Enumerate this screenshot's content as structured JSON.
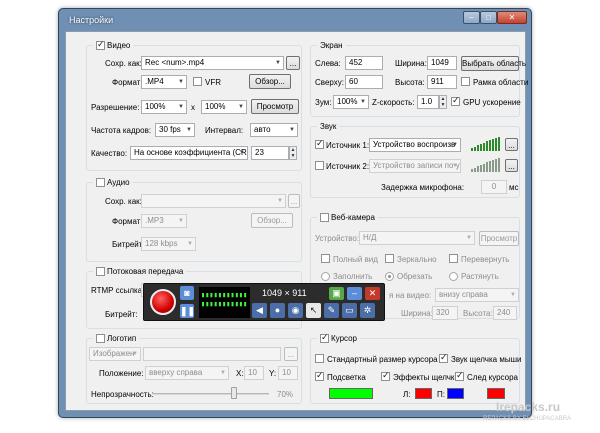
{
  "window": {
    "title": "Настройки"
  },
  "video": {
    "label": "Видео",
    "save_as_label": "Сохр. как:",
    "save_as_value": "Rec <num>.mp4",
    "format_label": "Формат:",
    "format_value": ".MP4",
    "vfr_label": "VFR",
    "browse_label": "Обзор...",
    "resolution_label": "Разрешение:",
    "res_w": "100%",
    "res_x": "x",
    "res_h": "100%",
    "preview_label": "Просмотр",
    "fps_label": "Частота кадров:",
    "fps_value": "30 fps",
    "interval_label": "Интервал:",
    "interval_value": "авто",
    "quality_label": "Качество:",
    "quality_mode": "На основе коэффициента (CR",
    "quality_value": "23",
    "more_label": "..."
  },
  "screen": {
    "label": "Экран",
    "left_label": "Слева:",
    "left_value": "452",
    "width_label": "Ширина:",
    "width_value": "1049",
    "select_area_label": "Выбрать область",
    "top_label": "Сверху:",
    "top_value": "60",
    "height_label": "Высота:",
    "height_value": "911",
    "frame_label": "Рамка области",
    "zoom_label": "Зум:",
    "zoom_value": "100%",
    "zspeed_label": "Z-скорость:",
    "zspeed_value": "1.0",
    "gpu_label": "GPU ускорение"
  },
  "sound": {
    "label": "Звук",
    "source1_label": "Источник 1:",
    "source1_value": "Устройство воспроизв",
    "source2_label": "Источник 2:",
    "source2_value": "Устройство записи по у",
    "mic_delay_label": "Задержка микрофона:",
    "mic_delay_value": "0",
    "mic_delay_unit": "мс"
  },
  "audio": {
    "label": "Аудио",
    "save_as_label": "Сохр. как:",
    "format_label": "Формат:",
    "format_value": ".MP3",
    "browse_label": "Обзор...",
    "bitrate_label": "Битрейт:",
    "bitrate_value": "128 kbps"
  },
  "webcam": {
    "label": "Веб-камера",
    "device_label": "Устройство:",
    "device_value": "Н/Д",
    "preview_label": "Просмотр",
    "fullview_label": "Полный вид",
    "mirror_label": "Зеркально",
    "flip_label": "Перевернуть",
    "fill_label": "Заполнить",
    "crop_label": "Обрезать",
    "stretch_label": "Растянуть",
    "position_label": "я на видео:",
    "position_value": "внизу справа",
    "width_label": "Ширина:",
    "width_value": "320",
    "height_label": "Высота:",
    "height_value": "240"
  },
  "stream": {
    "label": "Потоковая передача",
    "rtmp_label": "RTMP ссылка:",
    "bitrate_label": "Битрейт:"
  },
  "logo": {
    "label": "Логотип",
    "type_value": "Изображен",
    "position_label": "Положение:",
    "position_value": "вверху справа",
    "x_label": "X:",
    "x_value": "10",
    "y_label": "Y:",
    "y_value": "10",
    "opacity_label": "Непрозрачность:",
    "opacity_value": "70%",
    "opacity_fraction": 0.7
  },
  "cursor": {
    "label": "Курсор",
    "std_size_label": "Стандартный размер курсора",
    "click_sound_label": "Звук щелчка мыши",
    "highlight_label": "Подсветка",
    "click_fx_label": "Эффекты щелчка",
    "trail_label": "След курсора",
    "l_label": "Л:",
    "r_label": "П:",
    "highlight_color": "#00ff00",
    "left_color": "#ff0000",
    "right_color": "#0000ff",
    "trail_color": "#ff0000"
  },
  "recorder": {
    "size_text": "1049 × 911",
    "screen_text": "▮▮▮▮▮▮▮▮▮▮▮ ▮▮▮▮▮▮▮▮▮▮▮"
  },
  "watermark": {
    "site": "Irepacks.ru",
    "sub": "REPACKS BY ELCHUPACABRA"
  },
  "icons": [
    "camera-icon",
    "pause-icon",
    "speaker-icon",
    "microphone-icon",
    "webcam-icon",
    "cursor-icon",
    "pen-icon",
    "folder-icon",
    "gear-icon",
    "close-icon"
  ]
}
